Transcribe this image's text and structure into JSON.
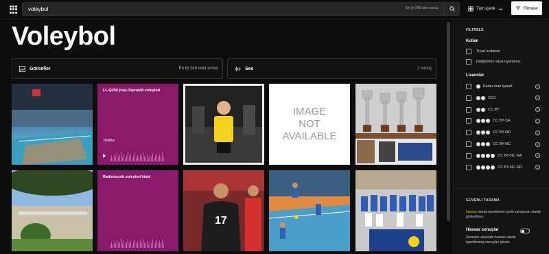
{
  "header": {
    "search_value": "voleybol",
    "search_count": "En iyi 240 adet sonuç",
    "content_type": "Tüm içerik",
    "filters_label": "Filtreler"
  },
  "page": {
    "title": "Voleybol"
  },
  "categories": [
    {
      "label": "Görseller",
      "count": "En iyi 240 adet sonuç",
      "icon": "image-icon"
    },
    {
      "label": "Ses",
      "count": "2 sonuç",
      "icon": "audio-wave-icon"
    }
  ],
  "audio_results": [
    {
      "title": "LL-Q256 (tur)-ToprakM-voleybol",
      "subtitle": "Telaffuz"
    },
    {
      "title": "Radiotecnik voleybol klubi",
      "subtitle": ""
    }
  ],
  "image_results": [
    {
      "name": "volleyball-arena-photo",
      "alt": ""
    },
    {
      "name": "volleyball-player-yellow-photo",
      "alt": ""
    },
    {
      "name": "image-not-available",
      "alt": "IMAGE NOT AVAILABLE"
    },
    {
      "name": "trophies-photo",
      "alt": ""
    },
    {
      "name": "outdoor-court-photo",
      "alt": ""
    },
    {
      "name": "turkish-player-photo",
      "alt": ""
    },
    {
      "name": "volleyball-match-photo",
      "alt": ""
    },
    {
      "name": "team-photo",
      "alt": ""
    }
  ],
  "filter_panel": {
    "heading": "FİLTRELE",
    "usage_heading": "Kullan",
    "usage_options": [
      "Ticari kullanım",
      "Değiştirme veya uyarlama"
    ],
    "licenses_heading": "Lisanslar",
    "licenses": [
      {
        "label": "Kamu malı işareti",
        "icons": 1
      },
      {
        "label": "CC0",
        "icons": 2
      },
      {
        "label": "CC BY",
        "icons": 2
      },
      {
        "label": "CC BY-SA",
        "icons": 3
      },
      {
        "label": "CC BY-ND",
        "icons": 3
      },
      {
        "label": "CC BY-NC",
        "icons": 3
      },
      {
        "label": "CC BY-NC-SA",
        "icons": 4
      },
      {
        "label": "CC BY-NC-ND",
        "icons": 4
      }
    ],
    "safe_heading": "GÜVENLİ TARAMA",
    "safe_highlight": "hassas",
    "safe_text": " olarak işaretlenen içerik varsayılan olarak gösterilmez.",
    "sensitive_label": "Hassas sonuçlar",
    "sensitive_desc": "Sonuçlar alanında hassas olarak işaretlenmiş sonuçları göster."
  },
  "colors": {
    "accent": "#8a1a6b",
    "highlight": "#e6c200"
  }
}
